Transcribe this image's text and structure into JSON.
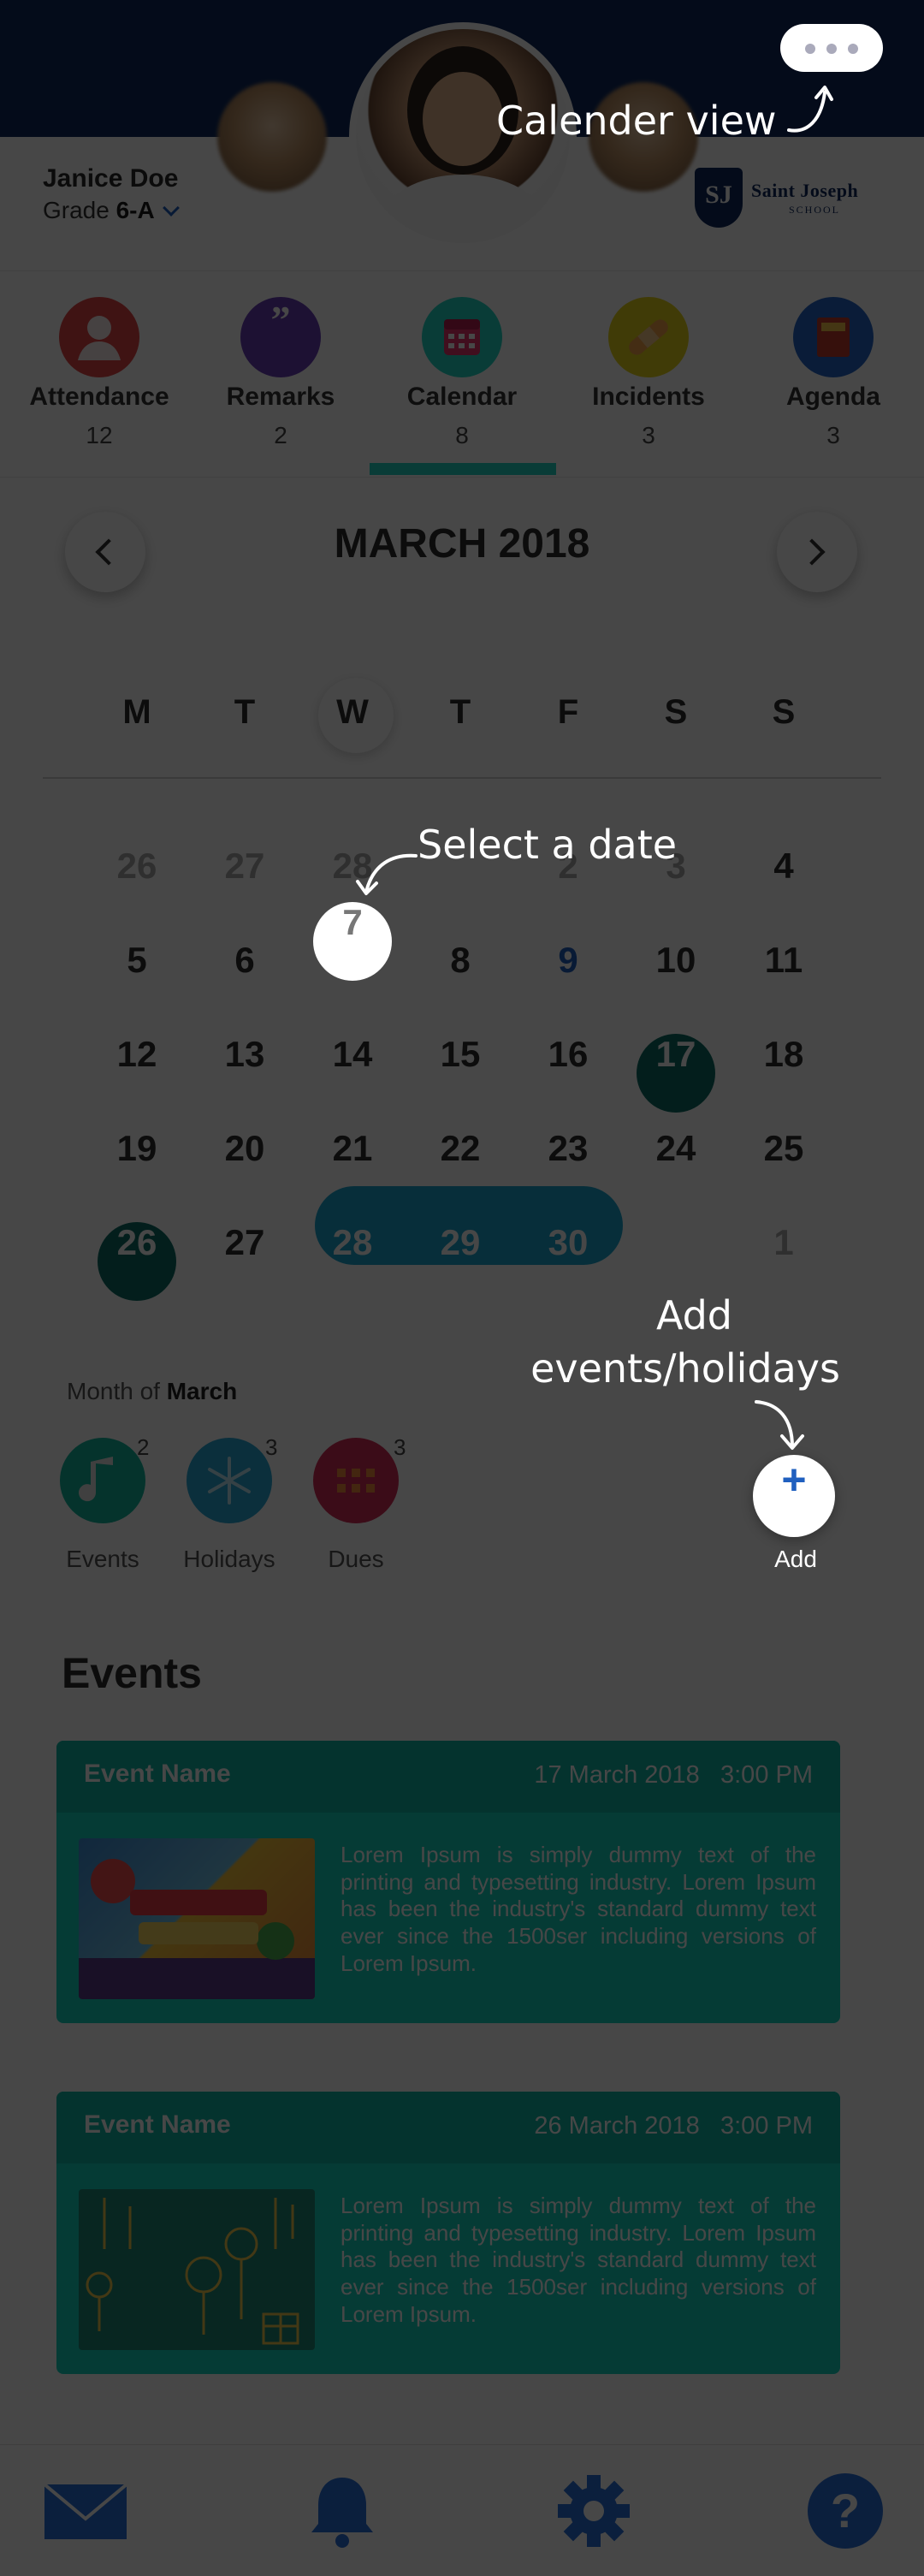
{
  "student": {
    "name": "Janice Doe",
    "grade_prefix": "Grade",
    "grade": "6-A"
  },
  "school": {
    "initials": "SJ",
    "name": "Saint Joseph",
    "sub": "SCHOOL"
  },
  "tabs": [
    {
      "label": "Attendance",
      "count": "12",
      "icon": "person-icon",
      "color": "#e04545"
    },
    {
      "label": "Remarks",
      "count": "2",
      "icon": "quote-icon",
      "color": "#6a3fb8"
    },
    {
      "label": "Calendar",
      "count": "8",
      "icon": "calendar-icon",
      "color": "#22d6c4",
      "active": true
    },
    {
      "label": "Incidents",
      "count": "3",
      "icon": "bandage-icon",
      "color": "#e6d21c"
    },
    {
      "label": "Agenda",
      "count": "3",
      "icon": "book-icon",
      "color": "#2466c8"
    }
  ],
  "calendar": {
    "month": "MARCH 2018",
    "weekdays": [
      "M",
      "T",
      "W",
      "T",
      "F",
      "S",
      "S"
    ],
    "weeks": [
      [
        "26",
        "27",
        "28",
        "",
        "2",
        "3",
        "4"
      ],
      [
        "5",
        "6",
        "7",
        "8",
        "9",
        "10",
        "11"
      ],
      [
        "12",
        "13",
        "14",
        "15",
        "16",
        "17",
        "18"
      ],
      [
        "19",
        "20",
        "21",
        "22",
        "23",
        "24",
        "25"
      ],
      [
        "26",
        "27",
        "28",
        "29",
        "30",
        "",
        "1"
      ]
    ]
  },
  "summary": {
    "prefix": "Month of",
    "month": "March",
    "categories": [
      {
        "label": "Events",
        "count": "2",
        "icon": "music-note-icon",
        "color": "#14b89e"
      },
      {
        "label": "Holidays",
        "count": "3",
        "icon": "snowflake-icon",
        "color": "#2aa8d6"
      },
      {
        "label": "Dues",
        "count": "3",
        "icon": "grid-icon",
        "color": "#d42e56"
      }
    ],
    "add_label": "Add"
  },
  "events": {
    "title": "Events",
    "items": [
      {
        "name": "Event Name",
        "date": "17 March 2018",
        "time": "3:00 PM",
        "image": "Captivating Imagination poster",
        "description": "Lorem Ipsum is simply dummy text of the printing and typesetting industry. Lorem Ipsum has been the industry's standard dummy text ever since the 1500ser including versions of Lorem Ipsum."
      },
      {
        "name": "Event Name",
        "date": "26 March 2018",
        "time": "3:00 PM",
        "image": "party balloons illustration",
        "description": "Lorem Ipsum is simply dummy text of the printing and typesetting industry. Lorem Ipsum has been the industry's standard dummy text ever since the 1500ser including versions of Lorem Ipsum."
      }
    ]
  },
  "bottom_nav": [
    "mail-icon",
    "bell-icon",
    "gear-icon",
    "help-icon"
  ],
  "coach_marks": {
    "calendar_view": "Calender view",
    "select_date": "Select a date",
    "add_line1": "Add",
    "add_line2": "events/holidays"
  }
}
